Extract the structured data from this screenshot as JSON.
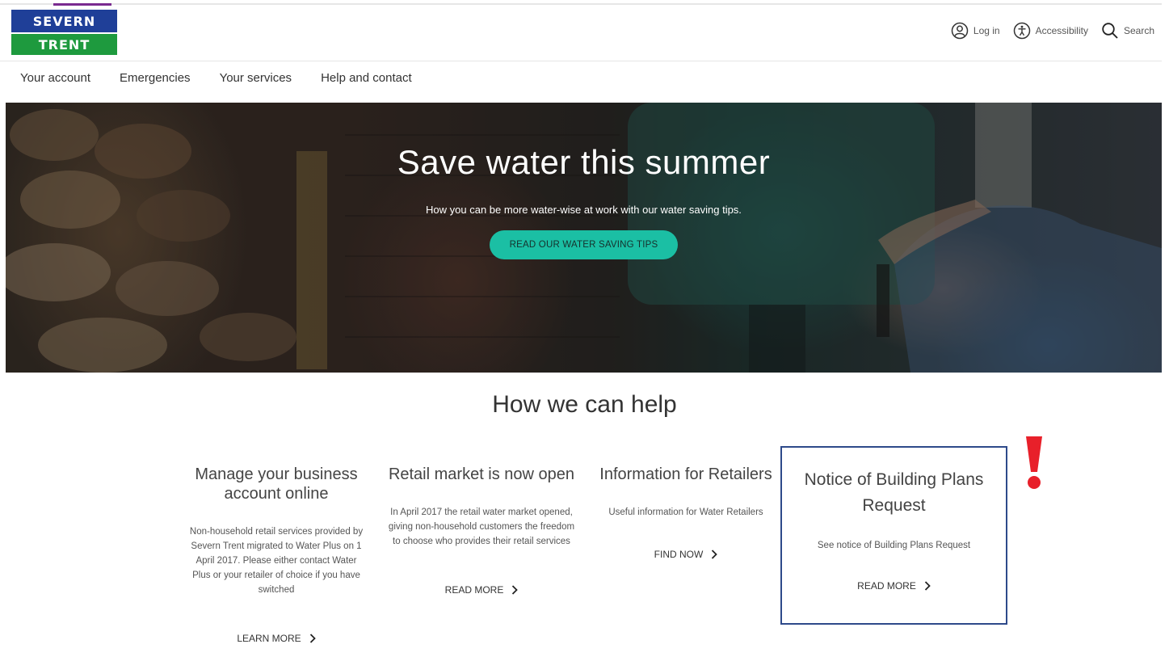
{
  "logo": {
    "top_text": "SEVERN",
    "bottom_text": "TRENT"
  },
  "utility_nav": {
    "login": "Log in",
    "accessibility": "Accessibility",
    "search": "Search"
  },
  "main_nav": [
    "Your account",
    "Emergencies",
    "Your services",
    "Help and contact"
  ],
  "hero": {
    "title": "Save water this summer",
    "subtitle": "How you can be more water-wise at work with our water saving tips.",
    "cta": "READ OUR WATER SAVING TIPS"
  },
  "help_section": {
    "title": "How we can help",
    "cards": [
      {
        "title": "Manage your business account online",
        "body": "Non-household retail services provided by Severn Trent migrated to Water Plus on 1 April 2017. Please either contact Water Plus or your retailer of choice if you have switched",
        "link": "LEARN MORE"
      },
      {
        "title": "Retail market is now open",
        "body": "In April 2017 the retail water market opened, giving non-household customers the freedom to choose who provides their retail services",
        "link": "READ MORE"
      },
      {
        "title": "Information for Retailers",
        "body": "Useful information for Water Retailers",
        "link": "FIND NOW"
      },
      {
        "title": "Notice of Building Plans Request",
        "body": "See notice of Building Plans Request",
        "link": "READ MORE"
      }
    ]
  },
  "colors": {
    "brand_blue": "#1f3f98",
    "brand_green": "#1e9a3e",
    "cta_teal": "#1bbfa4",
    "highlight_border": "#2e4a8a",
    "alert_red": "#e8202a"
  }
}
